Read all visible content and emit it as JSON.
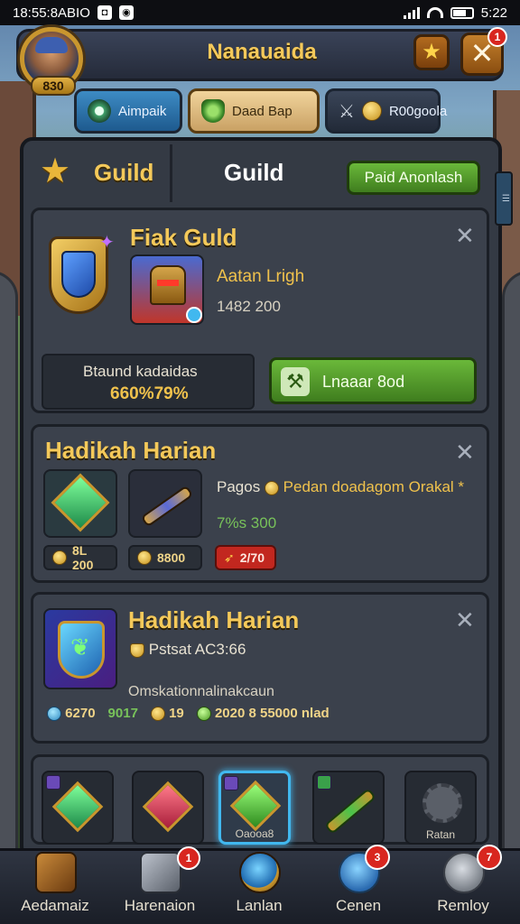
{
  "status_bar": {
    "left_text": "18:55:8ABIO",
    "time": "5:22"
  },
  "header": {
    "title": "Nanauaida",
    "level": "830",
    "close_badge": "1"
  },
  "tabs": [
    {
      "label": "Aimpaik",
      "icon": "eye-icon"
    },
    {
      "label": "Daad Bap",
      "icon": "leaf-shield-icon"
    },
    {
      "label": "R00goola",
      "icon": "coin-icon"
    }
  ],
  "panel": {
    "title_left": "Guild",
    "title_right": "Guild",
    "action_label": "Paid Anonlash"
  },
  "card1": {
    "title": "Fiak Guld",
    "subtitle": "Aatan Lrigh",
    "value": "1482 200",
    "reward_label": "Btaund kadaidas",
    "reward_value": "660%79%",
    "button_label": "Lnaaar 8od"
  },
  "card2": {
    "title": "Hadikah Harian",
    "desc": "Pagos",
    "desc_gold": "Pedan doadagom Orakal *",
    "value_green": "7%s 300",
    "chips": [
      {
        "label": "8L 200",
        "kind": "dark"
      },
      {
        "label": "8800",
        "kind": "dark"
      },
      {
        "label": "2/70",
        "kind": "red"
      }
    ]
  },
  "card3": {
    "title": "Hadikah Harian",
    "subtitle": "Pstsat AC3:66",
    "desc": "Omskationnalinakcaun",
    "stats": [
      "6270",
      "9017",
      "19",
      "2020 8 55000 nlad"
    ]
  },
  "items": [
    {
      "label": "",
      "icon": "green-gem-icon"
    },
    {
      "label": "",
      "icon": "red-gem-icon"
    },
    {
      "label": "Oaooa8",
      "icon": "green-gem-icon"
    },
    {
      "label": "",
      "icon": "green-sword-icon"
    },
    {
      "label": "Ratan",
      "icon": "locked-gear-icon"
    }
  ],
  "bottom_nav": [
    {
      "label": "Aedamaiz",
      "badge": ""
    },
    {
      "label": "Harenaion",
      "badge": "1"
    },
    {
      "label": "Lanlan",
      "badge": ""
    },
    {
      "label": "Cenen",
      "badge": "3"
    },
    {
      "label": "Remloy",
      "badge": "7"
    }
  ],
  "colors": {
    "gold": "#f4c95a",
    "green_button": "#4f9a2a",
    "panel": "#343a44",
    "red_badge": "#d8261f",
    "selected_slot": "#41b8ef"
  }
}
